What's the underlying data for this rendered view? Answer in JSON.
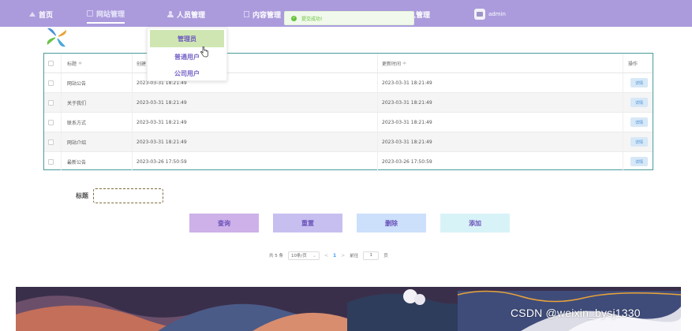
{
  "nav": {
    "items": [
      {
        "label": "首页",
        "icon": "home-icon"
      },
      {
        "label": "网站管理",
        "icon": "grid-icon",
        "active": true
      },
      {
        "label": "人员管理",
        "icon": "person-icon"
      },
      {
        "label": "内容管理",
        "icon": "doc-icon"
      },
      {
        "label": "人管理",
        "icon": "none"
      }
    ],
    "user": "admin"
  },
  "toast": {
    "message": "提交成功!",
    "type": "success"
  },
  "dropdown": {
    "items": [
      "管理员",
      "普通用户",
      "公司用户"
    ],
    "highlighted": "管理员"
  },
  "table": {
    "headers": {
      "title": "标题",
      "created": "创建",
      "updated": "更新时间",
      "actions": "操作"
    },
    "sort_mark": "≑",
    "detail_label": "详情",
    "rows": [
      {
        "title": "网站公告",
        "created": "2023-03-31 18:21:49",
        "updated": "2023-03-31 18:21:49"
      },
      {
        "title": "关于我们",
        "created": "2023-03-31 18:21:49",
        "updated": "2023-03-31 18:21:49"
      },
      {
        "title": "联系方式",
        "created": "2023-03-31 18:21:49",
        "updated": "2023-03-31 18:21:49"
      },
      {
        "title": "网站介绍",
        "created": "2023-03-31 18:21:49",
        "updated": "2023-03-31 18:21:49"
      },
      {
        "title": "最新公告",
        "created": "2023-03-26 17:50:59",
        "updated": "2023-03-26 17:50:59"
      }
    ]
  },
  "search": {
    "label": "标题",
    "value": "",
    "placeholder": ""
  },
  "buttons": {
    "query": "查询",
    "reset": "重置",
    "delete": "删除",
    "add": "添加"
  },
  "pagination": {
    "total": "共 5 条",
    "page_size": "10条/页",
    "prev": "<",
    "current": "1",
    "next": ">",
    "goto_label": "前往",
    "goto_value": "1",
    "page_suffix": "页"
  },
  "watermark": "CSDN @weixin_bysj1330",
  "colors": {
    "nav_bg": "#ab9bdc",
    "table_border": "#4a9c9c",
    "query": "#cdb1e8",
    "reset": "#c7bff0",
    "delete": "#cce0fb",
    "add": "#d8f3f8",
    "success": "#67c23a"
  }
}
